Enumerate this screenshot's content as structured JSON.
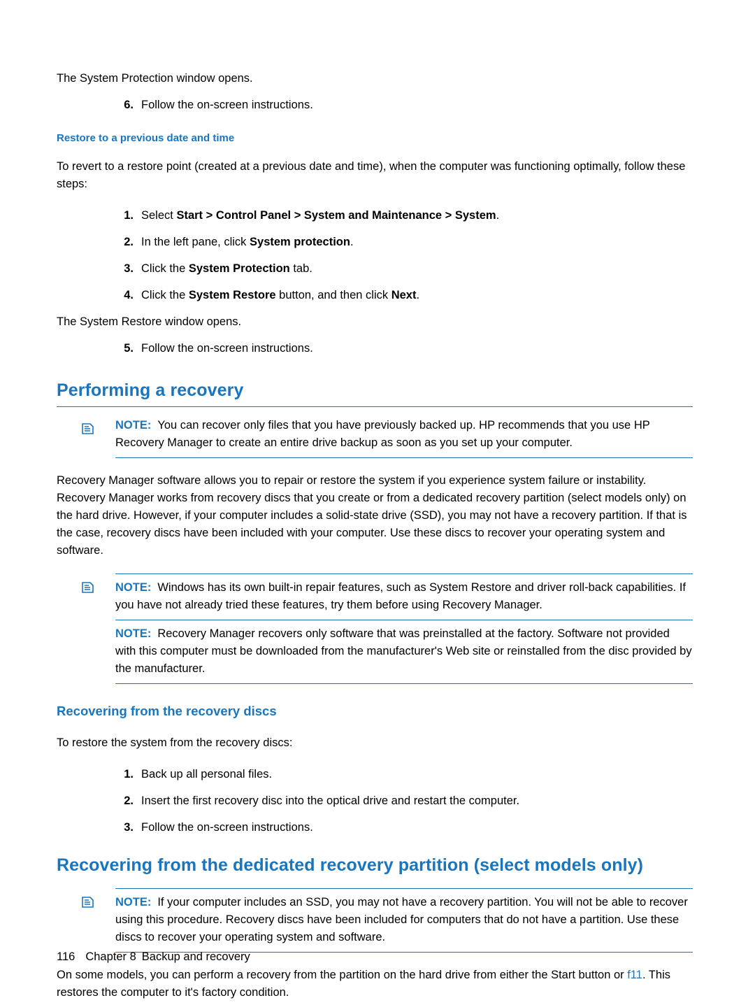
{
  "page": {
    "footer": {
      "page_number": "116",
      "chapter_label": "Chapter 8",
      "chapter_title": "Backup and recovery"
    }
  },
  "top_section": {
    "intro_line": "The System Protection window opens.",
    "step6": {
      "num": "6.",
      "text": "Follow the on-screen instructions."
    }
  },
  "restore_section": {
    "heading": "Restore to a previous date and time",
    "intro": "To revert to a restore point (created at a previous date and time), when the computer was functioning optimally, follow these steps:",
    "steps": [
      {
        "num": "1.",
        "pre": "Select ",
        "bold": "Start > Control Panel > System and Maintenance > System",
        "post": "."
      },
      {
        "num": "2.",
        "pre": "In the left pane, click ",
        "bold": "System protection",
        "post": "."
      },
      {
        "num": "3.",
        "pre": "Click the ",
        "bold": "System Protection",
        "post": " tab."
      },
      {
        "num": "4.",
        "pre": "Click the ",
        "bold": "System Restore",
        "mid": " button, and then click ",
        "bold2": "Next",
        "post": "."
      }
    ],
    "window_opens": "The System Restore window opens.",
    "step5": {
      "num": "5.",
      "text": "Follow the on-screen instructions."
    }
  },
  "performing_recovery": {
    "heading": "Performing a recovery",
    "note1": {
      "icon": "note-icon",
      "label": "NOTE:",
      "text": "You can recover only files that you have previously backed up. HP recommends that you use HP Recovery Manager to create an entire drive backup as soon as you set up your computer."
    },
    "paragraph1": "Recovery Manager software allows you to repair or restore the system if you experience system failure or instability. Recovery Manager works from recovery discs that you create or from a dedicated recovery partition (select models only) on the hard drive. However, if your computer includes a solid-state drive (SSD), you may not have a recovery partition. If that is the case, recovery discs have been included with your computer. Use these discs to recover your operating system and software.",
    "note2": {
      "icon": "note-icon",
      "label": "NOTE:",
      "text": "Windows has its own built-in repair features, such as System Restore and driver roll-back capabilities. If you have not already tried these features, try them before using Recovery Manager."
    },
    "note3": {
      "label": "NOTE:",
      "text": "Recovery Manager recovers only software that was preinstalled at the factory. Software not provided with this computer must be downloaded from the manufacturer's Web site or reinstalled from the disc provided by the manufacturer."
    }
  },
  "recovering_discs": {
    "heading": "Recovering from the recovery discs",
    "intro": "To restore the system from the recovery discs:",
    "steps": [
      {
        "num": "1.",
        "text": "Back up all personal files."
      },
      {
        "num": "2.",
        "text": "Insert the first recovery disc into the optical drive and restart the computer."
      },
      {
        "num": "3.",
        "text": "Follow the on-screen instructions."
      }
    ]
  },
  "recovering_partition": {
    "heading": "Recovering from the dedicated recovery partition (select models only)",
    "note": {
      "icon": "note-icon",
      "label": "NOTE:",
      "text": "If your computer includes an SSD, you may not have a recovery partition. You will not be able to recover using this procedure. Recovery discs have been included for computers that do not have a partition. Use these discs to recover your operating system and software."
    },
    "paragraph": {
      "pre": "On some models, you can perform a recovery from the partition on the hard drive from either the Start button or ",
      "link": "f11",
      "post": ". This restores the computer to it's factory condition."
    }
  }
}
